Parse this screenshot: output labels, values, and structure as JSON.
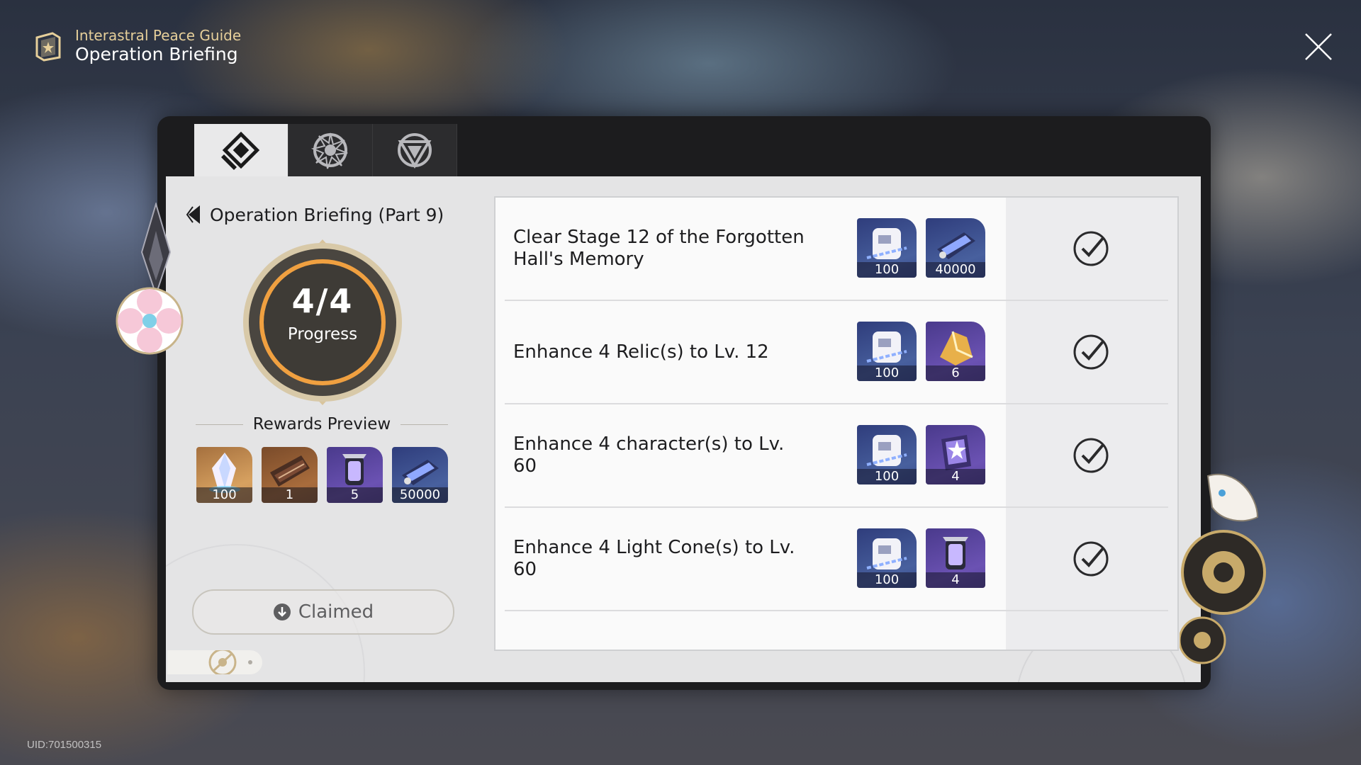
{
  "header": {
    "subtitle": "Interastral Peace Guide",
    "title": "Operation Briefing"
  },
  "uid": "UID:701500315",
  "tabs": [
    {
      "icon": "operation-briefing-icon",
      "active": true
    },
    {
      "icon": "star-compass-icon",
      "active": false
    },
    {
      "icon": "triangle-emblem-icon",
      "active": false
    }
  ],
  "briefing": {
    "back_label": "Operation Briefing (Part 9)",
    "progress_count": "4/4",
    "progress_label": "Progress",
    "progress": 1.0,
    "rewards_title": "Rewards Preview",
    "rewards": [
      {
        "icon": "stellar-jade-icon",
        "qty": "100",
        "rarity": "gold"
      },
      {
        "icon": "traveler-guide-icon",
        "qty": "1",
        "rarity": "brown"
      },
      {
        "icon": "refined-aether-icon",
        "qty": "5",
        "rarity": "purple"
      },
      {
        "icon": "credit-icon",
        "qty": "50000",
        "rarity": "blue"
      }
    ],
    "claimed_label": "Claimed"
  },
  "missions": [
    {
      "text": "Clear Stage 12 of the Forgotten Hall's Memory",
      "rewards": [
        {
          "icon": "guide-points-icon",
          "qty": "100"
        },
        {
          "icon": "credit-icon",
          "qty": "40000"
        }
      ],
      "done": true
    },
    {
      "text": "Enhance 4 Relic(s) to Lv. 12",
      "rewards": [
        {
          "icon": "guide-points-icon",
          "qty": "100"
        },
        {
          "icon": "gold-material-icon",
          "qty": "6"
        }
      ],
      "done": true
    },
    {
      "text": "Enhance 4 character(s) to Lv. 60",
      "rewards": [
        {
          "icon": "guide-points-icon",
          "qty": "100"
        },
        {
          "icon": "adventure-log-icon",
          "qty": "4"
        }
      ],
      "done": true
    },
    {
      "text": "Enhance 4 Light Cone(s) to Lv. 60",
      "rewards": [
        {
          "icon": "guide-points-icon",
          "qty": "100"
        },
        {
          "icon": "refined-aether-icon",
          "qty": "4"
        }
      ],
      "done": true
    }
  ],
  "colors": {
    "accent_gold": "#e6cf9a",
    "ring_orange": "#f0a040",
    "panel_bg": "#e4e4e5",
    "rarity_purple": "#6b52b3",
    "rarity_gold": "#d7a160"
  }
}
